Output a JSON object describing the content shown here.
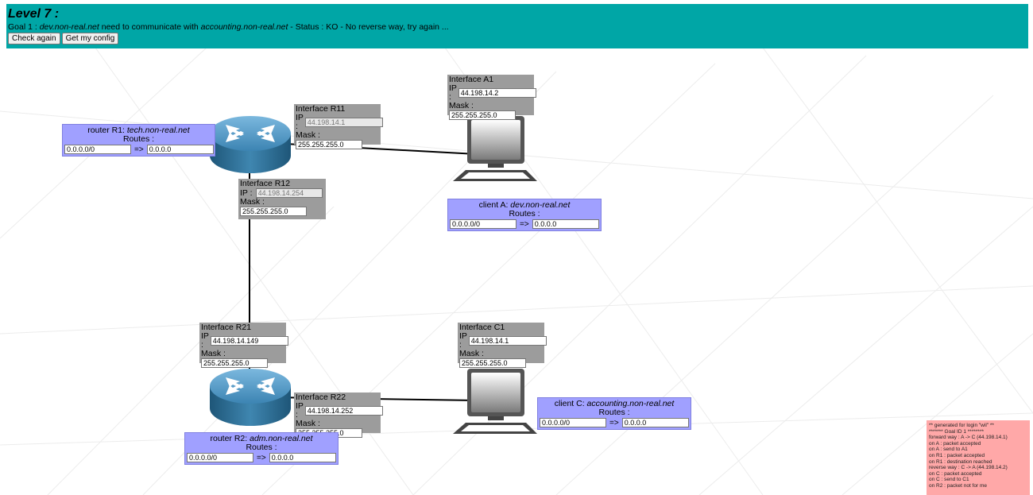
{
  "header": {
    "title": "Level 7 :",
    "goal_prefix": "Goal 1 : ",
    "goal_src": "dev.non-real.net",
    "goal_mid": " need to communicate with ",
    "goal_dst": "accounting.non-real.net",
    "goal_status": " - Status : KO - No reverse way, try again ...",
    "check_again_label": "Check again",
    "get_config_label": "Get my config"
  },
  "interfaces": {
    "r11": {
      "title": "Interface R11",
      "ip_label": "IP :",
      "ip": "44.198.14.1",
      "mask_label": "Mask :",
      "mask": "255.255.255.0"
    },
    "r12": {
      "title": "Interface R12",
      "ip_label": "IP :",
      "ip": "44.198.14.254",
      "mask_label": "Mask :",
      "mask": "255.255.255.0"
    },
    "a1": {
      "title": "Interface A1",
      "ip_label": "IP :",
      "ip": "44.198.14.2",
      "mask_label": "Mask :",
      "mask": "255.255.255.0"
    },
    "r21": {
      "title": "Interface R21",
      "ip_label": "IP :",
      "ip": "44.198.14.149",
      "mask_label": "Mask :",
      "mask": "255.255.255.0"
    },
    "r22": {
      "title": "Interface R22",
      "ip_label": "IP :",
      "ip": "44.198.14.252",
      "mask_label": "Mask :",
      "mask": "255.255.255.0"
    },
    "c1": {
      "title": "Interface C1",
      "ip_label": "IP :",
      "ip": "44.198.14.1",
      "mask_label": "Mask :",
      "mask": "255.255.255.0"
    }
  },
  "routes": {
    "r1": {
      "prefix": "router R1: ",
      "host": "tech.non-real.net",
      "label": "Routes :",
      "dest": "0.0.0.0/0",
      "arrow": "=>",
      "next_hop": "0.0.0.0"
    },
    "a": {
      "prefix": "client A: ",
      "host": "dev.non-real.net",
      "label": "Routes :",
      "dest": "0.0.0.0/0",
      "arrow": "=>",
      "next_hop": "0.0.0.0"
    },
    "r2": {
      "prefix": "router R2: ",
      "host": "adm.non-real.net",
      "label": "Routes :",
      "dest": "0.0.0.0/0",
      "arrow": "=>",
      "next_hop": "0.0.0.0"
    },
    "c": {
      "prefix": "client C: ",
      "host": "accounting.non-real.net",
      "label": "Routes :",
      "dest": "0.0.0.0/0",
      "arrow": "=>",
      "next_hop": "0.0.0.0"
    }
  },
  "log": [
    "** generated for login \"wil\" **",
    "******* Goal ID 1 ********",
    "forward way : A -> C (44.198.14.1)",
    "on A : packet accepted",
    "on A : send to A1",
    "on R1 : packet accepted",
    "on R1 : destination reached",
    "reverse way : C -> A (44.198.14.2)",
    "on C : packet accepted",
    "on C : send to C1",
    "on R2 : packet not for me"
  ],
  "colors": {
    "header_bg": "#00a6a6",
    "interface_bg": "#9c9c9c",
    "route_bg": "#a0a0ff",
    "log_bg": "#ffa8a8"
  },
  "icons": [
    "router-icon",
    "computer-icon"
  ]
}
